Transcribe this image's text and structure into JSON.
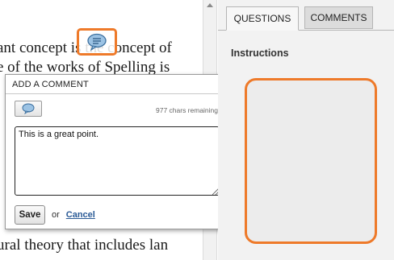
{
  "document": {
    "line1": "ant concept is the concept of",
    "line2": "e of the works of Spelling is",
    "line3": "ural theory that includes lan"
  },
  "comment_popup": {
    "title": "ADD A COMMENT",
    "chars_remaining": "977 chars remaining",
    "textarea_value": "This is a great point.",
    "save_label": "Save",
    "or_label": "or",
    "cancel_label": "Cancel"
  },
  "right_panel": {
    "tabs": [
      {
        "label": "QUESTIONS",
        "active": true
      },
      {
        "label": "COMMENTS",
        "active": false
      }
    ],
    "instructions_label": "Instructions"
  },
  "colors": {
    "highlight": "#ee7a2a",
    "link": "#2a5a96"
  },
  "icons": {
    "comment_trigger": "speech-bubble-icon",
    "insert_comment": "speech-bubble-icon"
  }
}
